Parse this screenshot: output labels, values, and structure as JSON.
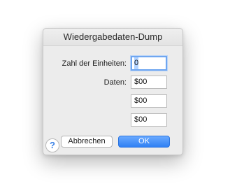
{
  "dialog": {
    "title": "Wiedergabedaten-Dump",
    "units_label": "Zahl der Einheiten:",
    "units_value": "0",
    "data_label": "Daten:",
    "data_values": [
      "$00",
      "$00",
      "$00"
    ],
    "help_glyph": "?",
    "cancel_label": "Abbrechen",
    "ok_label": "OK"
  },
  "colors": {
    "accent": "#2f80f4",
    "focus_ring": "#6fa6f0",
    "dialog_bg": "#ececec"
  }
}
